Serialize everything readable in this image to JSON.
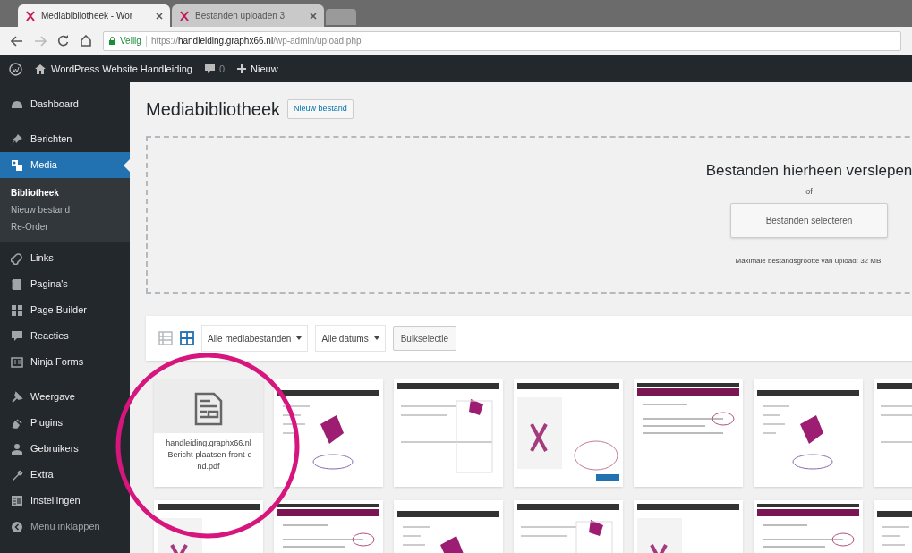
{
  "browser": {
    "tabs": [
      {
        "title": "Mediabibliotheek - Wor",
        "selected": true
      },
      {
        "title": "Bestanden uploaden 3",
        "selected": false
      }
    ],
    "address": {
      "secure_label": "Veilig",
      "url": "https://**handleiding.graphx66.nl**/wp-admin/upload.php"
    }
  },
  "admin_bar": {
    "site_name": "WordPress Website Handleiding",
    "comments": "0",
    "new": "Nieuw"
  },
  "sidebar": {
    "items": [
      {
        "label": "Dashboard",
        "selected": false
      },
      {
        "label": "Berichten",
        "selected": false
      },
      {
        "label": "Media",
        "selected": true,
        "children": [
          {
            "label": "Bibliotheek",
            "selected": true
          },
          {
            "label": "Nieuw bestand",
            "selected": false
          },
          {
            "label": "Re-Order",
            "selected": false
          }
        ]
      },
      {
        "label": "Links",
        "selected": false
      },
      {
        "label": "Pagina's",
        "selected": false
      },
      {
        "label": "Page Builder",
        "selected": false
      },
      {
        "label": "Reacties",
        "selected": false
      },
      {
        "label": "Ninja Forms",
        "selected": false
      },
      {
        "label": "Weergave",
        "selected": false
      },
      {
        "label": "Plugins",
        "selected": false
      },
      {
        "label": "Gebruikers",
        "selected": false
      },
      {
        "label": "Extra",
        "selected": false
      },
      {
        "label": "Instellingen",
        "selected": false
      },
      {
        "label": "Menu inklappen",
        "selected": false
      }
    ]
  },
  "page": {
    "title": "Mediabibliotheek",
    "add_new": "Nieuw bestand"
  },
  "uploader": {
    "heading": "Bestanden hierheen verslepen",
    "or": "of",
    "select_button": "Bestanden selecteren",
    "max_size": "Maximale bestandsgrootte van upload: 32 MB."
  },
  "toolbar": {
    "view_modes": [
      {
        "selected": false
      },
      {
        "selected": true
      }
    ],
    "type_filter": "Alle mediabestanden",
    "date_filter": "Alle datums",
    "bulk_button": "Bulkselectie"
  },
  "media": [
    {
      "kind": "file",
      "filename": "handleiding.graphx66.nl-Bericht-plaatsen-front-end.pdf"
    },
    {
      "kind": "picture"
    },
    {
      "kind": "picture"
    },
    {
      "kind": "picture"
    },
    {
      "kind": "picture"
    },
    {
      "kind": "picture"
    },
    {
      "kind": "picture"
    },
    {
      "kind": "picture"
    },
    {
      "kind": "picture"
    },
    {
      "kind": "picture"
    },
    {
      "kind": "picture"
    },
    {
      "kind": "picture"
    },
    {
      "kind": "picture"
    },
    {
      "kind": "picture"
    }
  ],
  "annotation": {
    "kind": "circle",
    "color": "#d6167d"
  }
}
